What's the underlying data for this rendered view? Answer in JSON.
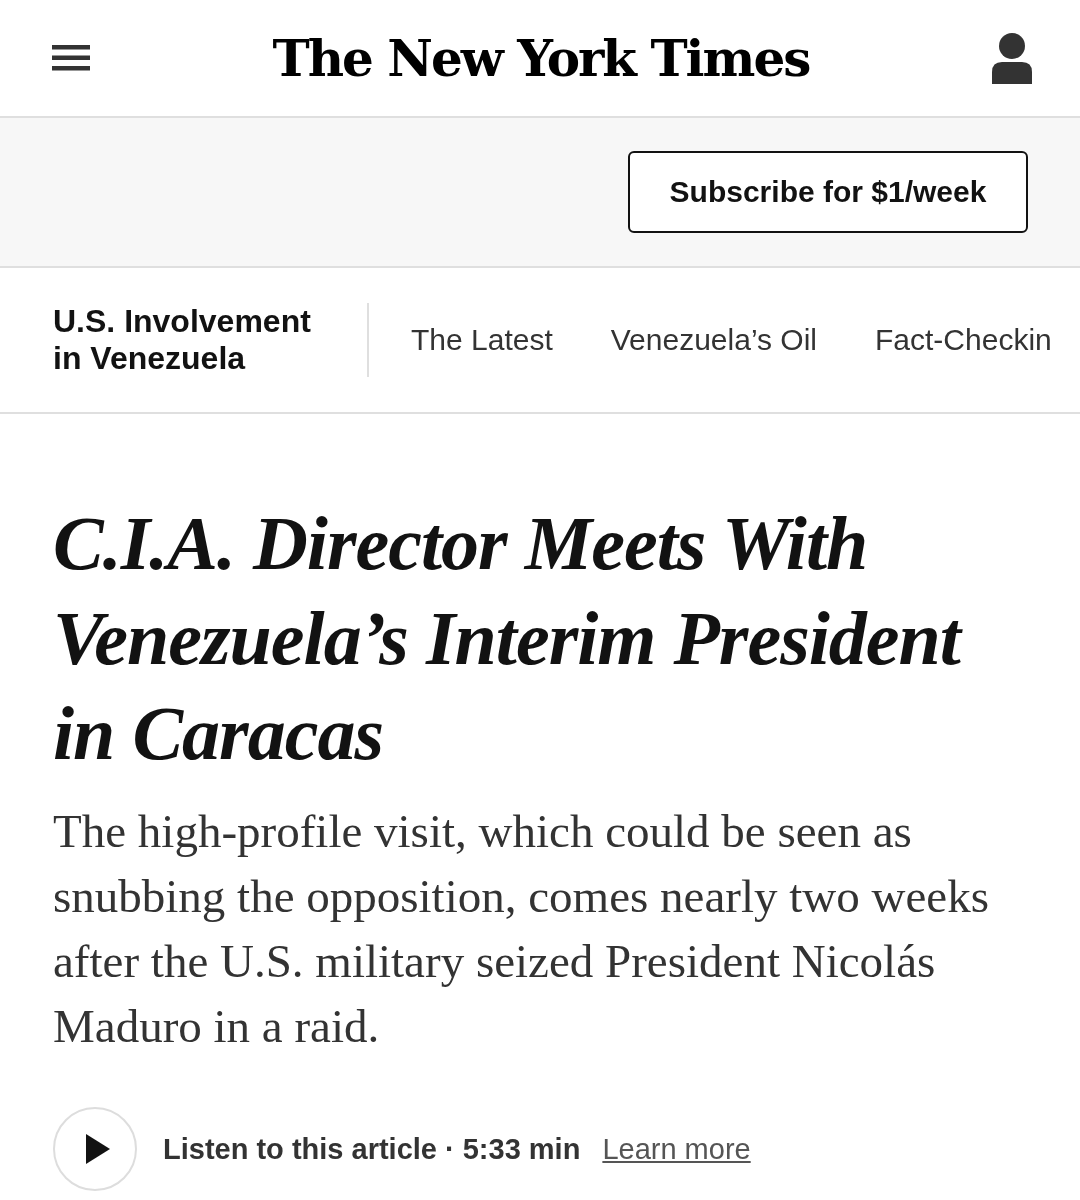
{
  "header": {
    "logo": "The New York Times"
  },
  "subscribe_button": "Subscribe for $1/week",
  "section_nav": {
    "title": "U.S. Involvement in Venezuela",
    "tabs": [
      {
        "label": "The Latest"
      },
      {
        "label": "Venezuela’s Oil"
      },
      {
        "label": "Fact-Checkin"
      }
    ]
  },
  "headline": "C.I.A. Director Meets With Venezuela’s Interim President in Caracas",
  "summary": "The high-profile visit, which could be seen as snubbing the opposition, comes nearly two weeks after the U.S. military seized President Nicolás Maduro in a raid.",
  "audio": {
    "label": "Listen to this article · 5:33 min",
    "link": "Learn more"
  }
}
